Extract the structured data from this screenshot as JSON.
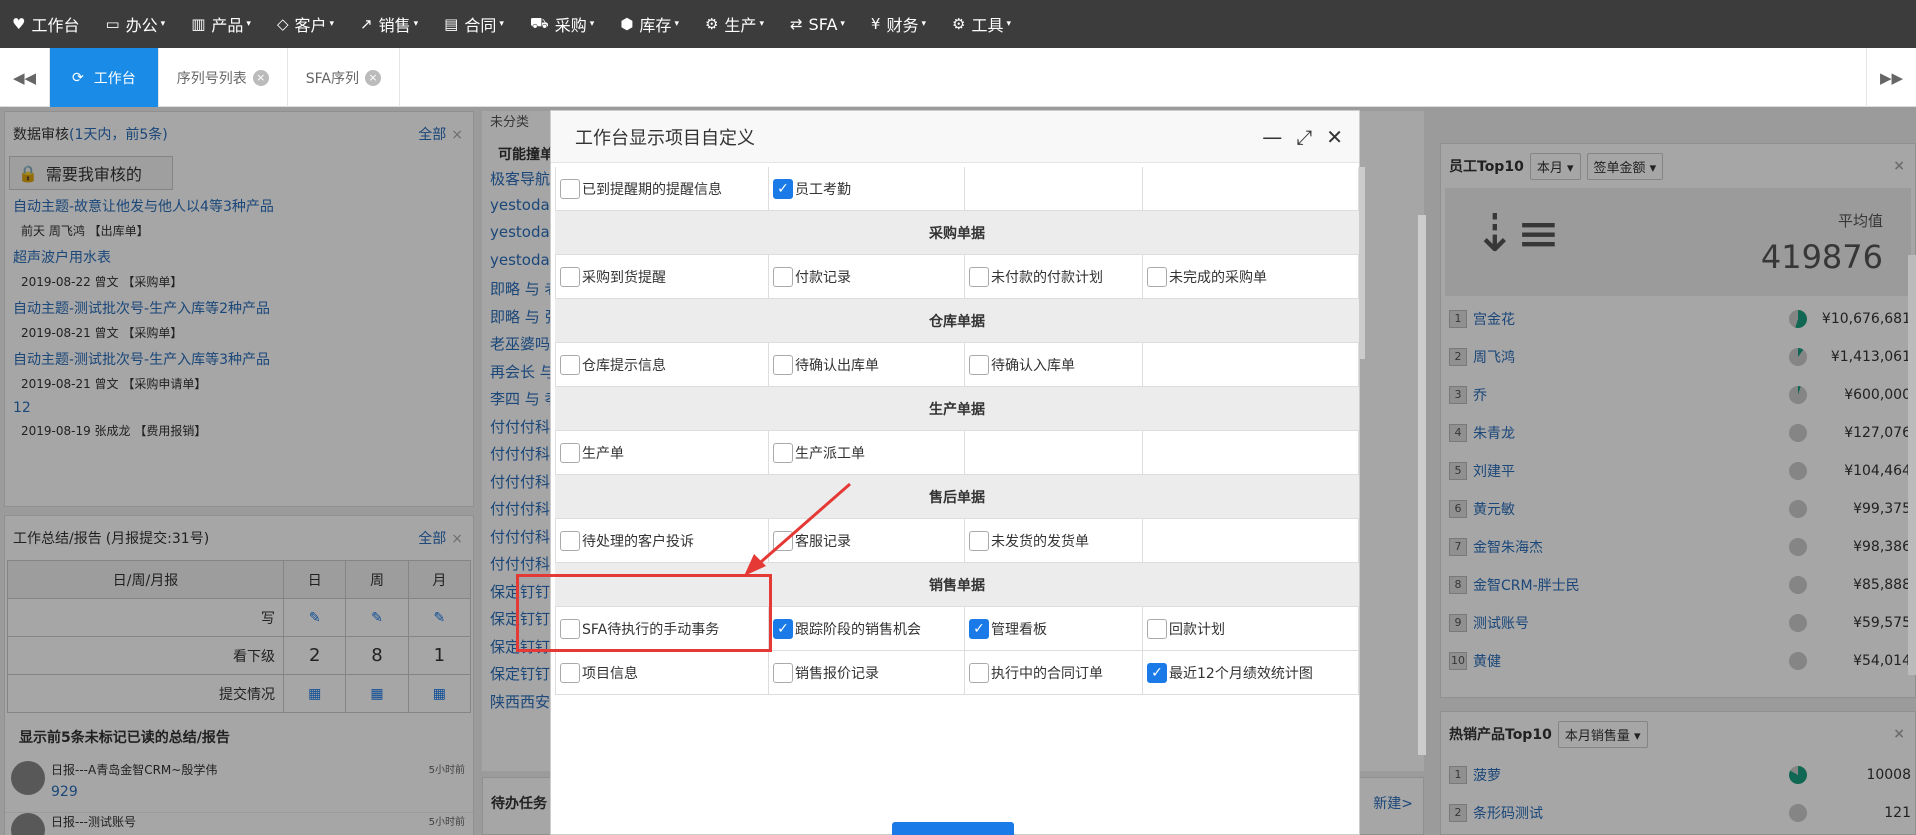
{
  "topnav": [
    {
      "icon": "heart-icon",
      "glyph": "♥",
      "label": "工作台",
      "caret": ""
    },
    {
      "icon": "monitor-icon",
      "glyph": "▭",
      "label": "办公",
      "caret": "▾"
    },
    {
      "icon": "barcode-icon",
      "glyph": "▥",
      "label": "产品",
      "caret": "▾"
    },
    {
      "icon": "diamond-icon",
      "glyph": "◇",
      "label": "客户",
      "caret": "▾"
    },
    {
      "icon": "line-chart-icon",
      "glyph": "↗",
      "label": "销售",
      "caret": "▾"
    },
    {
      "icon": "contract-icon",
      "glyph": "▤",
      "label": "合同",
      "caret": "▾"
    },
    {
      "icon": "cart-icon",
      "glyph": "⛟",
      "label": "采购",
      "caret": "▾"
    },
    {
      "icon": "cubes-icon",
      "glyph": "⬢",
      "label": "库存",
      "caret": "▾"
    },
    {
      "icon": "cogs-icon",
      "glyph": "⚙",
      "label": "生产",
      "caret": "▾"
    },
    {
      "icon": "retweet-icon",
      "glyph": "⇄",
      "label": "SFA",
      "caret": "▾"
    },
    {
      "icon": "yen-icon",
      "glyph": "¥",
      "label": "财务",
      "caret": "▾"
    },
    {
      "icon": "gear-icon",
      "glyph": "⚙",
      "label": "工具",
      "caret": "▾"
    }
  ],
  "tabs": {
    "active": "工作台",
    "others": [
      "序列号列表",
      "SFA序列"
    ]
  },
  "left": {
    "audit_title": "数据审核",
    "audit_note": "(1天内，前5条)",
    "all": "全部",
    "my_review": "需要我审核的",
    "items": [
      {
        "t": "自动主题-故意让他发与他人以4等3种产品",
        "m": "前天 周飞鸿 【出库单】"
      },
      {
        "t": "超声波户用水表",
        "m": "2019-08-22 曾文 【采购单】"
      },
      {
        "t": "自动主题-测试批次号-生产入库等2种产品",
        "m": "2019-08-21 曾文 【采购单】"
      },
      {
        "t": "自动主题-测试批次号-生产入库等3种产品",
        "m": "2019-08-21 曾文 【采购申请单】"
      },
      {
        "t": "12",
        "m": "2019-08-19 张成龙 【费用报销】"
      }
    ],
    "report_title": "工作总结/报告",
    "report_note": "(月报提交:31号)",
    "table": {
      "headers": [
        "日/周/月报",
        "日",
        "周",
        "月"
      ],
      "row_write": "写",
      "row_sub": "看下级",
      "counts": [
        "2",
        "8",
        "1"
      ],
      "row_submit": "提交情况"
    },
    "unread": "显示前5条未标记已读的总结/报告",
    "reports": [
      {
        "t": "日报---A青岛金智CRM~殷学伟",
        "v": "929",
        "time": "5小时前"
      },
      {
        "t": "日报---测试账号",
        "v": "",
        "time": "5小时前"
      }
    ]
  },
  "mid": {
    "top": "未分类",
    "possible": "可能撞单",
    "links": [
      "极客导航",
      "yestoday",
      "yestoday",
      "yestoday",
      "即略 与 老",
      "即略 与 张",
      "老巫婆吗",
      "再会长 与",
      "李四 与 孝",
      "付付付科",
      "付付付科",
      "付付付科",
      "付付付科",
      "付付付科",
      "付付付科",
      "保定钉钉",
      "保定钉钉",
      "保定钉钉",
      "保定钉钉",
      "陕西西安"
    ],
    "todo": "待办任务",
    "new": "新建>"
  },
  "modal": {
    "title": "工作台显示项目自定义",
    "rows": [
      {
        "type": "items",
        "cells": [
          {
            "label": "已到提醒期的提醒信息",
            "checked": false
          },
          {
            "label": "员工考勤",
            "checked": true
          },
          {
            "label": "",
            "checked": null
          },
          {
            "label": "",
            "checked": null
          }
        ]
      },
      {
        "type": "section",
        "label": "采购单据"
      },
      {
        "type": "items",
        "cells": [
          {
            "label": "采购到货提醒",
            "checked": false
          },
          {
            "label": "付款记录",
            "checked": false
          },
          {
            "label": "未付款的付款计划",
            "checked": false
          },
          {
            "label": "未完成的采购单",
            "checked": false
          }
        ]
      },
      {
        "type": "section",
        "label": "仓库单据"
      },
      {
        "type": "items",
        "cells": [
          {
            "label": "仓库提示信息",
            "checked": false
          },
          {
            "label": "待确认出库单",
            "checked": false
          },
          {
            "label": "待确认入库单",
            "checked": false
          },
          {
            "label": "",
            "checked": null
          }
        ]
      },
      {
        "type": "section",
        "label": "生产单据"
      },
      {
        "type": "items",
        "cells": [
          {
            "label": "生产单",
            "checked": false
          },
          {
            "label": "生产派工单",
            "checked": false
          },
          {
            "label": "",
            "checked": null
          },
          {
            "label": "",
            "checked": null
          }
        ]
      },
      {
        "type": "section",
        "label": "售后单据"
      },
      {
        "type": "items",
        "cells": [
          {
            "label": "待处理的客户投诉",
            "checked": false
          },
          {
            "label": "客服记录",
            "checked": false
          },
          {
            "label": "未发货的发货单",
            "checked": false
          },
          {
            "label": "",
            "checked": null
          }
        ]
      },
      {
        "type": "section",
        "label": "销售单据"
      },
      {
        "type": "items",
        "cells": [
          {
            "label": "SFA待执行的手动事务",
            "checked": false
          },
          {
            "label": "跟踪阶段的销售机会",
            "checked": true
          },
          {
            "label": "管理看板",
            "checked": true
          },
          {
            "label": "回款计划",
            "checked": false
          }
        ]
      },
      {
        "type": "items",
        "cells": [
          {
            "label": "项目信息",
            "checked": false
          },
          {
            "label": "销售报价记录",
            "checked": false
          },
          {
            "label": "执行中的合同订单",
            "checked": false
          },
          {
            "label": "最近12个月绩效统计图",
            "checked": true
          }
        ]
      }
    ]
  },
  "right": {
    "title": "员工Top10",
    "period": "本月",
    "metric": "签单金额",
    "avg_label": "平均值",
    "avg_value": "419876",
    "ranks": [
      {
        "n": "1",
        "name": "宫金花",
        "amt": "¥10,676,681",
        "share": 0.55
      },
      {
        "n": "2",
        "name": "周飞鸿",
        "amt": "¥1,413,061",
        "share": 0.1
      },
      {
        "n": "3",
        "name": "乔",
        "amt": "¥600,000",
        "share": 0.05
      },
      {
        "n": "4",
        "name": "朱青龙",
        "amt": "¥127,076",
        "share": 0
      },
      {
        "n": "5",
        "name": "刘建平",
        "amt": "¥104,464",
        "share": 0
      },
      {
        "n": "6",
        "name": "黄元敏",
        "amt": "¥99,375",
        "share": 0
      },
      {
        "n": "7",
        "name": "金智朱海杰",
        "amt": "¥98,386",
        "share": 0
      },
      {
        "n": "8",
        "name": "金智CRM-胖士民",
        "amt": "¥85,888",
        "share": 0
      },
      {
        "n": "9",
        "name": "测试账号",
        "amt": "¥59,575",
        "share": 0
      },
      {
        "n": "10",
        "name": "黄健",
        "amt": "¥54,014",
        "share": 0
      }
    ],
    "prod_title": "热销产品Top10",
    "prod_period": "本月销售量",
    "products": [
      {
        "n": "1",
        "name": "菠萝",
        "amt": "10008"
      },
      {
        "n": "2",
        "name": "条形码测试",
        "amt": "121"
      }
    ]
  },
  "colors": {
    "accent": "#1a8ce8",
    "annotation": "#e53935",
    "topnav": "#3c3c3c"
  }
}
